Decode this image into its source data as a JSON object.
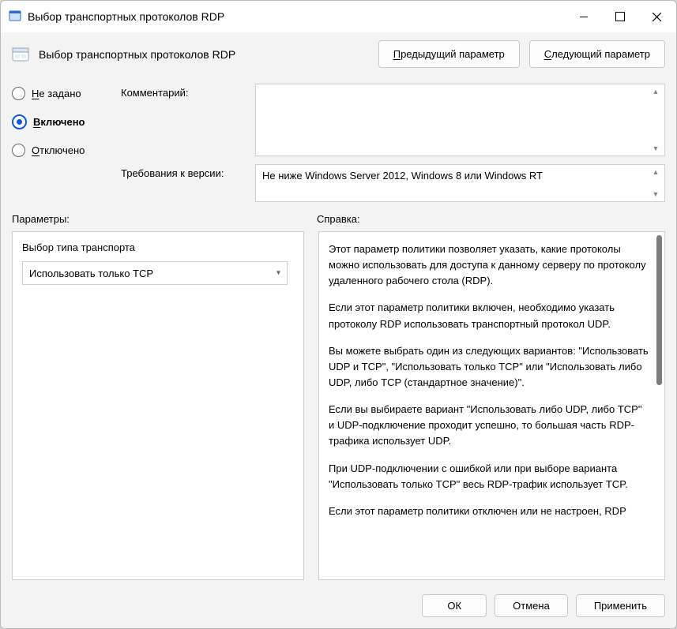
{
  "window": {
    "title": "Выбор транспортных протоколов RDP"
  },
  "header": {
    "title": "Выбор транспортных протоколов RDP",
    "prev": "Предыдущий параметр",
    "next": "Следующий параметр",
    "prev_first": "П",
    "prev_rest": "редыдущий параметр",
    "next_first": "С",
    "next_rest": "ледующий параметр"
  },
  "radios": {
    "not_configured_first": "Н",
    "not_configured_rest": "е задано",
    "enabled_first": "В",
    "enabled_rest": "ключено",
    "disabled_first": "О",
    "disabled_rest": "тключено",
    "selected": "enabled"
  },
  "labels": {
    "comment": "Комментарий:",
    "supported": "Требования к версии:",
    "options": "Параметры:",
    "help": "Справка:"
  },
  "comment_value": "",
  "supported_value": "Не ниже Windows Server 2012, Windows 8 или Windows RT",
  "options": {
    "transport_label": "Выбор типа транспорта",
    "transport_value": "Использовать только TCP"
  },
  "help": {
    "p1": "Этот параметр политики позволяет указать, какие протоколы можно использовать для доступа к данному серверу по протоколу удаленного рабочего стола (RDP).",
    "p2": "Если этот параметр политики включен, необходимо указать протоколу RDP использовать транспортный протокол UDP.",
    "p3": "Вы можете выбрать один из следующих вариантов: \"Использовать UDP и TCP\", \"Использовать только TCP\" или \"Использовать либо UDP, либо TCP (стандартное значение)\".",
    "p4": "Если вы выбираете вариант \"Использовать либо UDP, либо TCP\" и UDP-подключение проходит успешно, то большая часть RDP-трафика использует UDP.",
    "p5": "При UDP-подключении с ошибкой или при выборе варианта \"Использовать только TCP\" весь RDP-трафик использует TCP.",
    "p6": "Если этот параметр политики отключен или не настроен, RDP"
  },
  "footer": {
    "ok": "ОК",
    "cancel": "Отмена",
    "apply": "Применить"
  }
}
